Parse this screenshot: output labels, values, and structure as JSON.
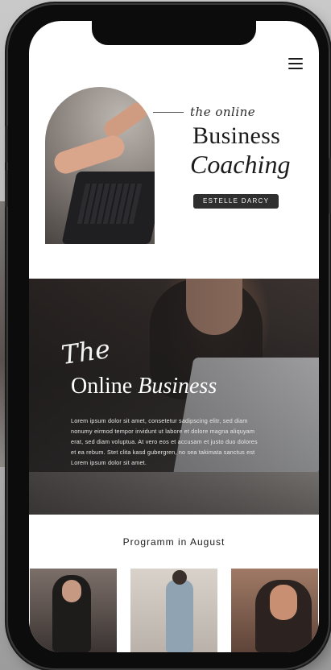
{
  "hero": {
    "script_text": "the online",
    "title_line1": "Business",
    "title_line2": "Coaching",
    "badge": "ESTELLE DARCY"
  },
  "promo": {
    "script_word": "The",
    "headline_regular": "Online ",
    "headline_italic": "Business",
    "body": "Lorem ipsum dolor sit amet, consetetur sadipscing elitr, sed diam nonumy eirmod tempor invidunt ut labore et dolore magna aliquyam erat, sed diam voluptua. At vero eos et accusam et justo duo dolores et ea rebum. Stet clita kasd gubergren, no sea takimata sanctus est Lorem ipsum dolor sit amet."
  },
  "program": {
    "title": "Programm in August"
  },
  "icons": {
    "menu": "hamburger-menu-icon"
  }
}
